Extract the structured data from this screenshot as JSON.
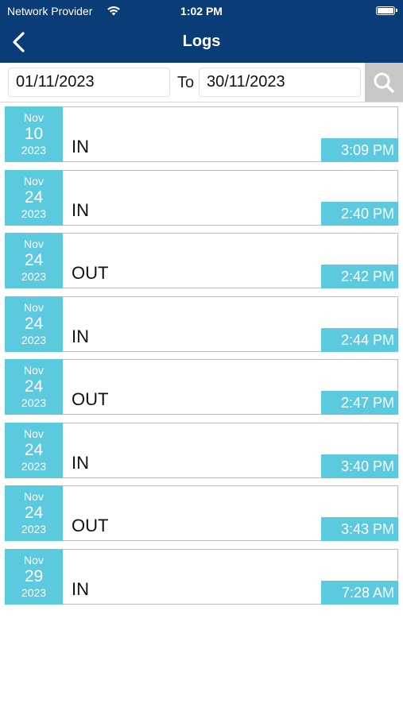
{
  "status_bar": {
    "carrier": "Network Provider",
    "time": "1:02 PM",
    "wifi_icon": "wifi-icon",
    "battery_icon": "battery-icon"
  },
  "nav": {
    "title": "Logs",
    "back_icon": "chevron-left-icon"
  },
  "filter": {
    "from_date": "01/11/2023",
    "to_label": "To",
    "to_date": "30/11/2023",
    "search_icon": "search-icon"
  },
  "colors": {
    "header_bg": "#0a3d78",
    "accent": "#5bc9de",
    "search_bg": "#c7c7c7"
  },
  "logs": [
    {
      "month": "Nov",
      "day": "10",
      "year": "2023",
      "type": "IN",
      "time": "3:09 PM"
    },
    {
      "month": "Nov",
      "day": "24",
      "year": "2023",
      "type": "IN",
      "time": "2:40 PM"
    },
    {
      "month": "Nov",
      "day": "24",
      "year": "2023",
      "type": "OUT",
      "time": "2:42 PM"
    },
    {
      "month": "Nov",
      "day": "24",
      "year": "2023",
      "type": "IN",
      "time": "2:44 PM"
    },
    {
      "month": "Nov",
      "day": "24",
      "year": "2023",
      "type": "OUT",
      "time": "2:47 PM"
    },
    {
      "month": "Nov",
      "day": "24",
      "year": "2023",
      "type": "IN",
      "time": "3:40 PM"
    },
    {
      "month": "Nov",
      "day": "24",
      "year": "2023",
      "type": "OUT",
      "time": "3:43 PM"
    },
    {
      "month": "Nov",
      "day": "29",
      "year": "2023",
      "type": "IN",
      "time": "7:28 AM"
    }
  ]
}
